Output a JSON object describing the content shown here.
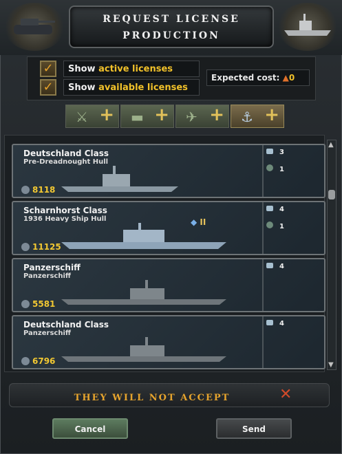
{
  "header": {
    "title_line1": "Request License",
    "title_line2": "Production"
  },
  "filters": {
    "active": {
      "prefix": "Show ",
      "highlight": "active licenses",
      "checked": true
    },
    "available": {
      "prefix": "Show ",
      "highlight": "available licenses",
      "checked": true
    },
    "checkmark": "✓"
  },
  "cost": {
    "label": "Expected cost:",
    "value": "0"
  },
  "tabs": [
    {
      "icon": "infantry-icon",
      "glyph": "⚔",
      "plus": "+"
    },
    {
      "icon": "tank-icon",
      "glyph": "▬",
      "plus": "+"
    },
    {
      "icon": "plane-icon",
      "glyph": "✈",
      "plus": "+"
    },
    {
      "icon": "anchor-icon",
      "glyph": "⚓",
      "plus": "+"
    }
  ],
  "ships": [
    {
      "name": "Deutschland Class",
      "hull": "Pre-Dreadnought Hull",
      "price": "8118",
      "res1": "3",
      "res2": "1",
      "tier": ""
    },
    {
      "name": "Scharnhorst Class",
      "hull": "1936 Heavy Ship Hull",
      "price": "11125",
      "res1": "4",
      "res2": "1",
      "tier": "II"
    },
    {
      "name": "Panzerschiff",
      "hull": "Panzerschiff",
      "price": "5581",
      "res1": "4",
      "res2": "",
      "tier": ""
    },
    {
      "name": "Deutschland Class",
      "hull": "Panzerschiff",
      "price": "6796",
      "res1": "4",
      "res2": "",
      "tier": ""
    }
  ],
  "warning": {
    "text": "They will NOT accept",
    "icon": "close-icon"
  },
  "buttons": {
    "cancel": "Cancel",
    "send": "Send"
  },
  "colors": {
    "accent": "#f1c12a",
    "warning": "#e6a42d"
  }
}
